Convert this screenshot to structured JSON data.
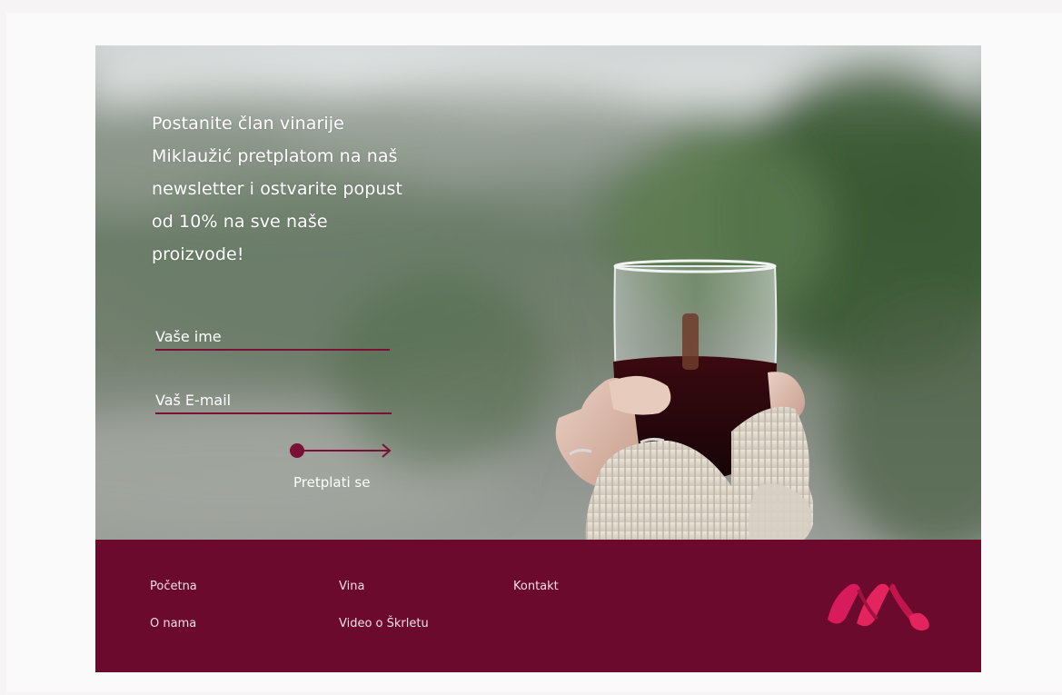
{
  "hero": {
    "headline": "Postanite član vinarije Miklaužić pretplatom na naš newsletter i ostvarite popust od 10% na sve naše proizvode!",
    "name_placeholder": "Vaše ime",
    "email_placeholder": "Vaš E-mail",
    "submit_label": "Pretplati se"
  },
  "footer": {
    "links": [
      {
        "label": "Početna"
      },
      {
        "label": "O nama"
      },
      {
        "label": "Vina"
      },
      {
        "label": "Video o Škrletu"
      },
      {
        "label": "Kontakt"
      }
    ]
  },
  "colors": {
    "brand": "#6b0a2c",
    "accent": "#7a1035",
    "logo": "#d81b5a",
    "text_light": "#ffffff"
  },
  "icons": {
    "submit": "arrow-right-icon",
    "logo": "miklauzic-wave-logo"
  }
}
